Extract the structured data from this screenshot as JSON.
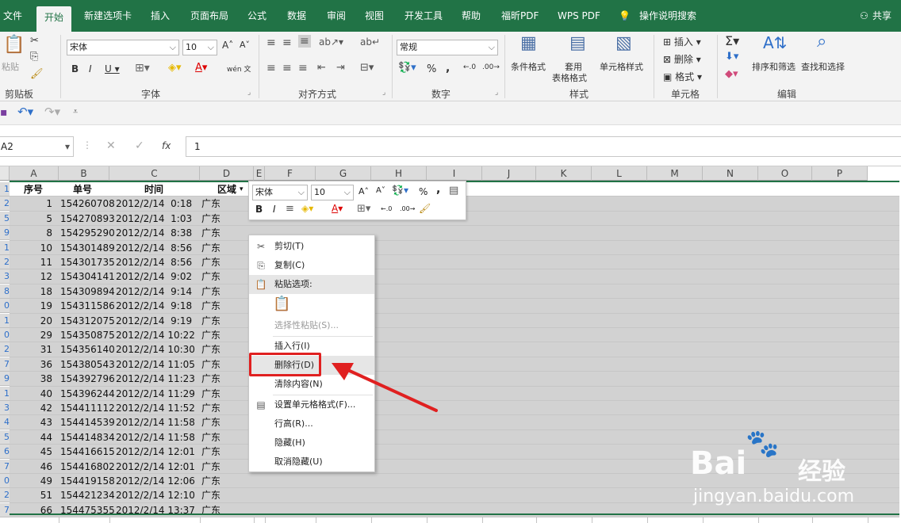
{
  "tabs": [
    "文件",
    "开始",
    "新建选项卡",
    "插入",
    "页面布局",
    "公式",
    "数据",
    "审阅",
    "视图",
    "开发工具",
    "帮助",
    "福昕PDF",
    "WPS PDF",
    "操作说明搜索"
  ],
  "share": "共享",
  "ribbon": {
    "clipboard": {
      "paste": "粘贴",
      "label": "剪贴板"
    },
    "font": {
      "name": "宋体",
      "size": "10",
      "label": "字体",
      "wen": "wén 文"
    },
    "align": {
      "label": "对齐方式"
    },
    "number": {
      "format": "常规",
      "label": "数字"
    },
    "styles": {
      "cond": "条件格式",
      "table1": "套用",
      "table2": "表格格式",
      "cell": "单元格样式",
      "label": "样式"
    },
    "cells": {
      "insert": "插入",
      "delete": "删除",
      "format": "格式",
      "label": "单元格"
    },
    "edit": {
      "sort": "排序和筛选",
      "find": "查找和选择",
      "label": "编辑"
    }
  },
  "namebox": "A2",
  "formula": "1",
  "columns": [
    "A",
    "B",
    "C",
    "D",
    "E",
    "F",
    "G",
    "H",
    "I",
    "J",
    "K",
    "L",
    "M",
    "N",
    "O",
    "P"
  ],
  "row_numbers": [
    "1",
    "2",
    "5",
    "9",
    "1",
    "2",
    "3",
    "8",
    "0",
    "1",
    "0",
    "2",
    "7",
    "9",
    "1",
    "3",
    "4",
    "5",
    "6",
    "7",
    "0",
    "2",
    "7"
  ],
  "headers": {
    "seq": "序号",
    "num": "单号",
    "time": "时间",
    "region": "区域"
  },
  "rows": [
    [
      "1",
      "154260708",
      "2012/2/14  0:18",
      "广东"
    ],
    [
      "5",
      "154270893",
      "2012/2/14  1:03",
      "广东"
    ],
    [
      "8",
      "154295290",
      "2012/2/14  8:38",
      "广东"
    ],
    [
      "10",
      "154301489",
      "2012/2/14  8:56",
      "广东"
    ],
    [
      "11",
      "154301735",
      "2012/2/14  8:56",
      "广东"
    ],
    [
      "12",
      "154304141",
      "2012/2/14  9:02",
      "广东"
    ],
    [
      "18",
      "154309894",
      "2012/2/14  9:14",
      "广东"
    ],
    [
      "19",
      "154311586",
      "2012/2/14  9:18",
      "广东"
    ],
    [
      "20",
      "154312075",
      "2012/2/14  9:19",
      "广东"
    ],
    [
      "29",
      "154350875",
      "2012/2/14 10:22",
      "广东"
    ],
    [
      "31",
      "154356140",
      "2012/2/14 10:30",
      "广东"
    ],
    [
      "36",
      "154380543",
      "2012/2/14 11:05",
      "广东"
    ],
    [
      "38",
      "154392796",
      "2012/2/14 11:23",
      "广东"
    ],
    [
      "40",
      "154396244",
      "2012/2/14 11:29",
      "广东"
    ],
    [
      "42",
      "154411112",
      "2012/2/14 11:52",
      "广东"
    ],
    [
      "43",
      "154414539",
      "2012/2/14 11:58",
      "广东"
    ],
    [
      "44",
      "154414834",
      "2012/2/14 11:58",
      "广东"
    ],
    [
      "45",
      "154416615",
      "2012/2/14 12:01",
      "广东"
    ],
    [
      "46",
      "154416802",
      "2012/2/14 12:01",
      "广东"
    ],
    [
      "49",
      "154419158",
      "2012/2/14 12:06",
      "广东"
    ],
    [
      "51",
      "154421234",
      "2012/2/14 12:10",
      "广东"
    ],
    [
      "66",
      "154475355",
      "2012/2/14 13:37",
      "广东"
    ]
  ],
  "mini_toolbar": {
    "font": "宋体",
    "size": "10"
  },
  "context_menu": {
    "cut": "剪切(T)",
    "copy": "复制(C)",
    "paste_options": "粘贴选项:",
    "paste_special": "选择性粘贴(S)...",
    "insert_row": "插入行(I)",
    "delete_row": "删除行(D)",
    "clear": "清除内容(N)",
    "format_cells": "设置单元格格式(F)...",
    "row_height": "行高(R)...",
    "hide": "隐藏(H)",
    "unhide": "取消隐藏(U)"
  },
  "watermark": {
    "brand": "Bai",
    "brand2": "经验",
    "url": "jingyan.baidu.com"
  },
  "colors": {
    "excel_green": "#217346",
    "highlight": "#e02020"
  }
}
